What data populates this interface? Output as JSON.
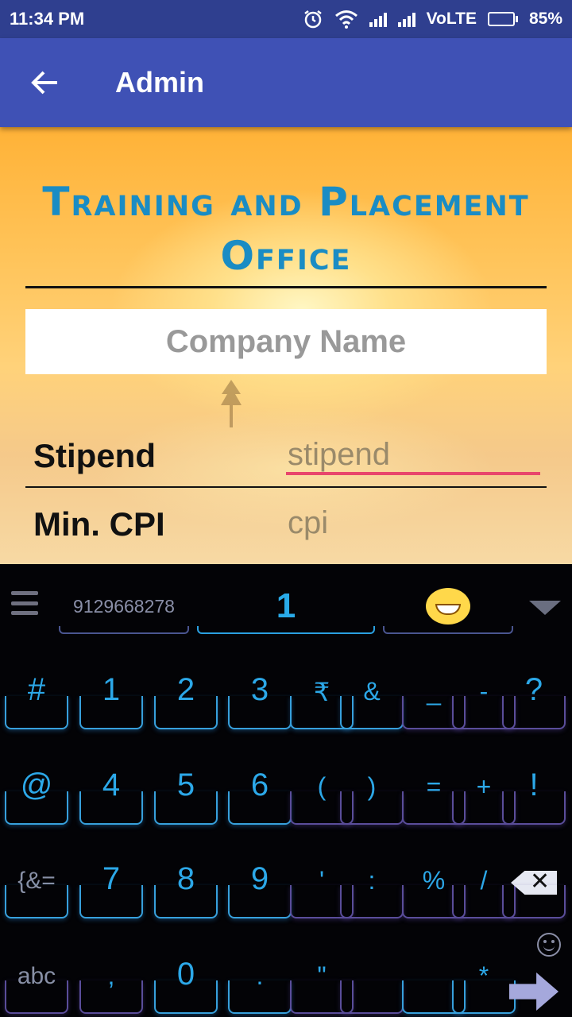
{
  "status_bar": {
    "time": "11:34 PM",
    "network": "VoLTE",
    "battery": "85%",
    "battery_level": 0.85
  },
  "app_bar": {
    "title": "Admin",
    "back_icon": "arrow-left-icon"
  },
  "form": {
    "heading_line1": "Training and Placement",
    "heading_line2": "Office",
    "company_placeholder": "Company Name",
    "stipend_label": "Stipend",
    "stipend_placeholder": "stipend",
    "cpi_label": "Min. CPI",
    "cpi_placeholder": "cpi"
  },
  "keyboard": {
    "suggestion_left": "9129668278",
    "suggestion_middle": "1",
    "suggestion_right_icon": "laughing-emoji-icon",
    "row1": [
      "#",
      "1",
      "2",
      "3",
      "₹",
      "&",
      "_",
      "-",
      "?"
    ],
    "row2": [
      "@",
      "4",
      "5",
      "6",
      "(",
      ")",
      "=",
      "+",
      "!"
    ],
    "row3": [
      "{&=",
      "7",
      "8",
      "9",
      "'",
      ":",
      "%",
      "/"
    ],
    "row4": [
      "abc",
      ",",
      "0",
      ".",
      "\"",
      "*"
    ]
  }
}
